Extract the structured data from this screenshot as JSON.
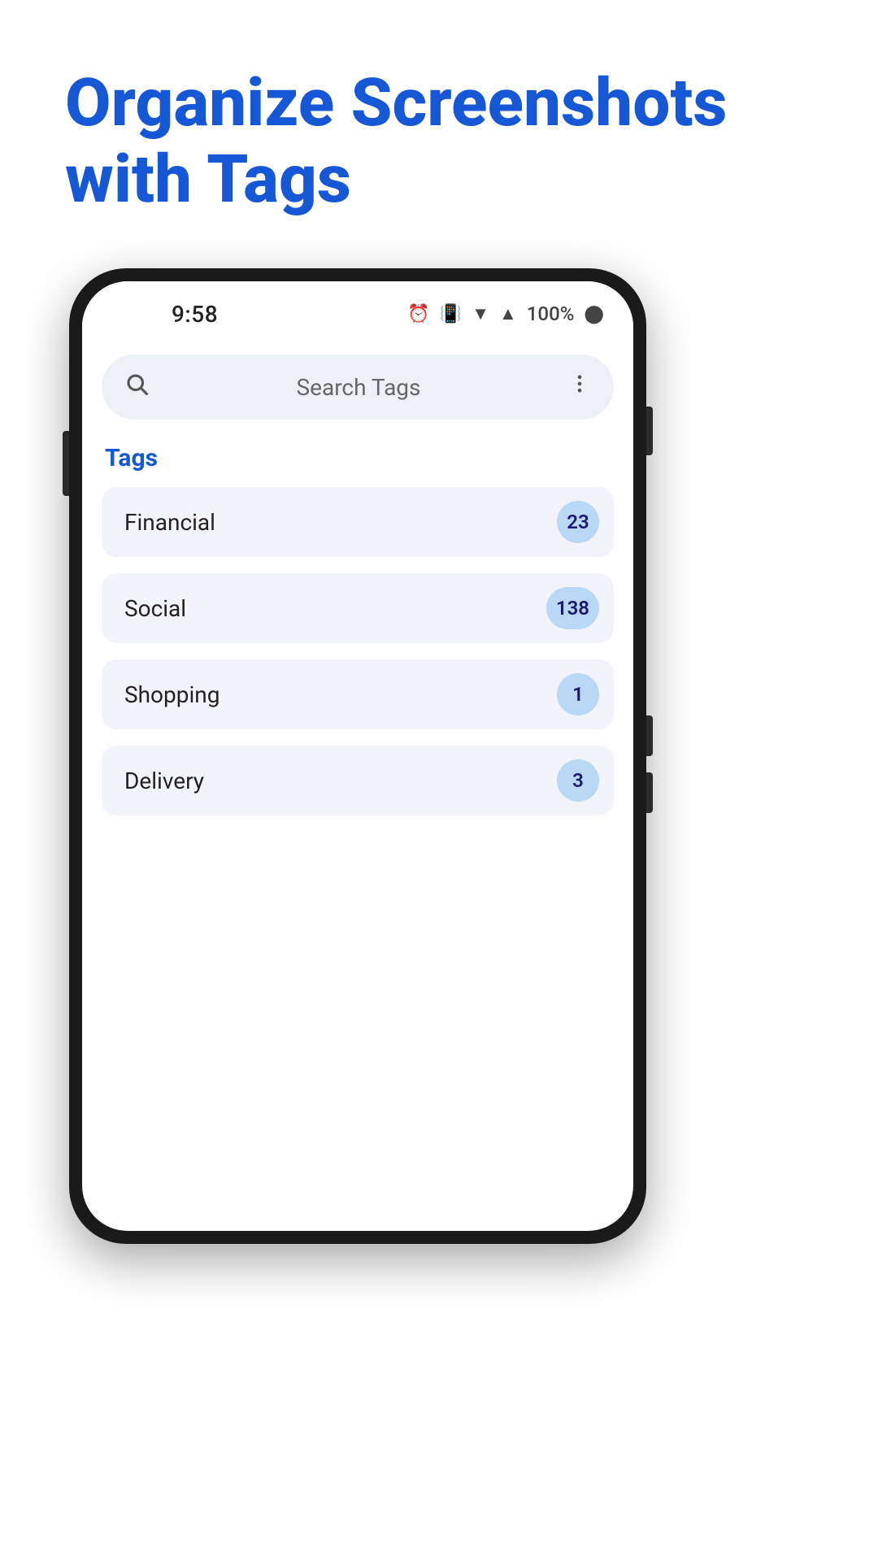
{
  "headline": {
    "line1": "Organize Screenshots",
    "line2": "with Tags"
  },
  "phone": {
    "statusBar": {
      "time": "9:58",
      "battery": "100%"
    },
    "searchBar": {
      "placeholder": "Search Tags",
      "searchIconLabel": "search",
      "moreIconLabel": "more options"
    },
    "tagsSection": {
      "label": "Tags",
      "items": [
        {
          "name": "Financial",
          "count": "23"
        },
        {
          "name": "Social",
          "count": "138"
        },
        {
          "name": "Shopping",
          "count": "1"
        },
        {
          "name": "Delivery",
          "count": "3"
        }
      ]
    }
  }
}
